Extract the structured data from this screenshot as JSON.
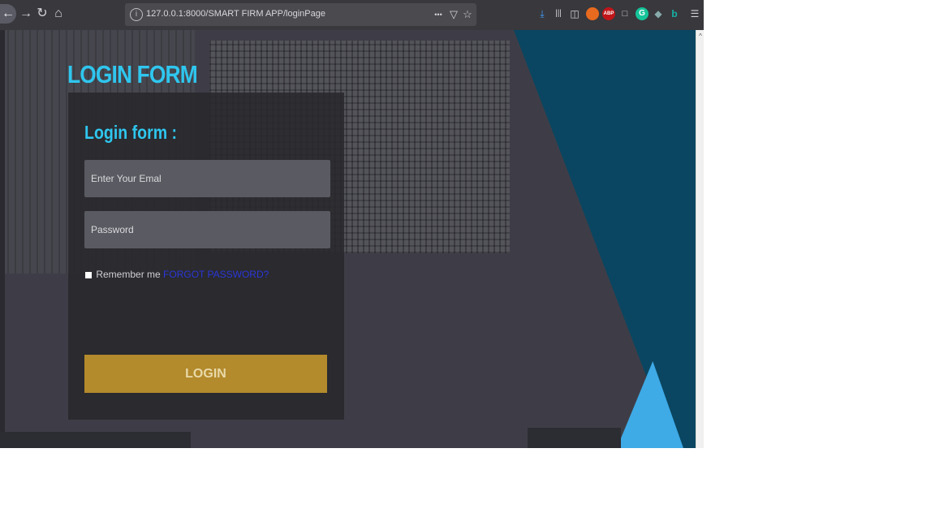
{
  "browser": {
    "url": "127.0.0.1:8000/SMART FIRM APP/loginPage",
    "back_icon": "←",
    "forward_icon": "→",
    "reload_icon": "↻",
    "home_icon": "⌂",
    "more_icon": "•••",
    "pocket_icon": "▽",
    "bookmark_icon": "☆",
    "download_icon": "⤓",
    "library_icon": "|||",
    "sidebar_icon": "◫",
    "menu_icon": "☰",
    "ext_abp_label": "ABP",
    "ext_grammarly_label": "G"
  },
  "page": {
    "header_title": "LOGIN FORM",
    "form_title": "Login form :",
    "email_placeholder": "Enter Your Emal",
    "password_placeholder": "Password",
    "remember_label": "Remember me",
    "forgot_link": "FORGOT PASSWORD?",
    "login_button": "LOGIN"
  },
  "colors": {
    "accent_cyan": "#2fc6ee",
    "button_gold": "#b38a2c",
    "triangle_dark": "#0a4661",
    "triangle_light": "#3eaae6"
  }
}
